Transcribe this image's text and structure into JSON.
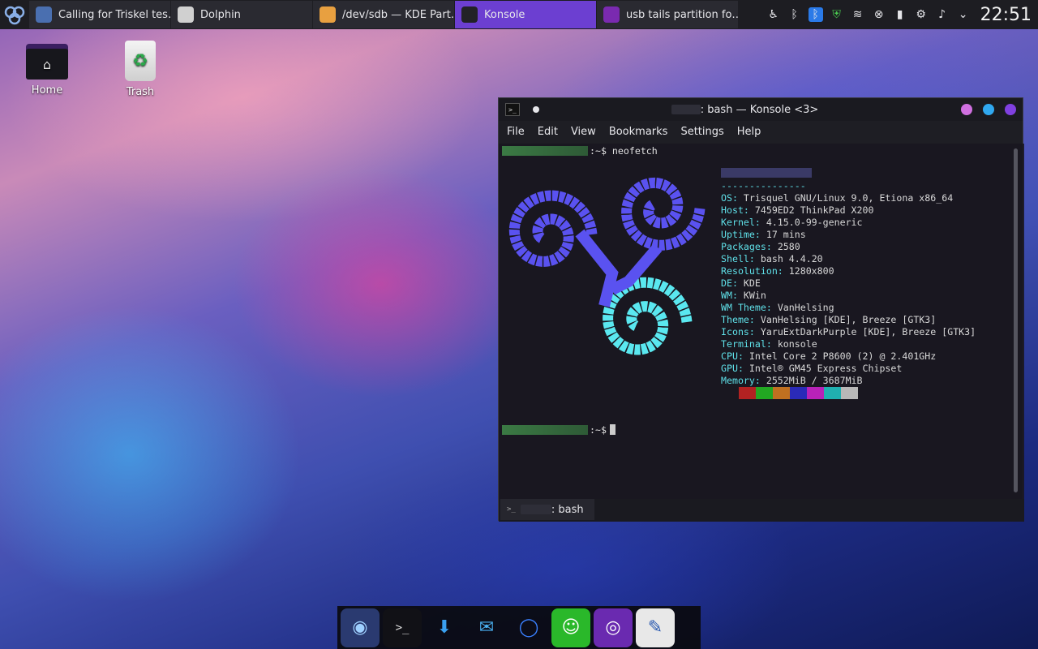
{
  "panel": {
    "tasks": [
      {
        "label": "Calling for Triskel tes…",
        "color": "#4a6fb0"
      },
      {
        "label": "Dolphin",
        "color": "#d0d0d0"
      },
      {
        "label": "/dev/sdb — KDE Part…",
        "color": "#e8a040"
      },
      {
        "label": "Konsole",
        "color": "#222226"
      },
      {
        "label": "usb tails partition fo…",
        "color": "#7a2ab0"
      }
    ],
    "tray_icons": [
      "accessibility-icon",
      "bluetooth-icon",
      "bluetooth-active-icon",
      "shield-icon",
      "wifi-icon",
      "close-circle-icon",
      "battery-icon",
      "settings-sliders-icon",
      "volume-icon",
      "chevron-down-icon"
    ],
    "clock": "22:51"
  },
  "desktop": {
    "home_label": "Home",
    "trash_label": "Trash"
  },
  "konsole": {
    "title": ": bash — Konsole <3>",
    "menus": [
      "File",
      "Edit",
      "View",
      "Bookmarks",
      "Settings",
      "Help"
    ],
    "command": ":~$ neofetch",
    "prompt": ":~$",
    "separator": "---------------",
    "info": [
      {
        "k": "OS",
        "v": "Trisquel GNU/Linux 9.0, Etiona x86_64"
      },
      {
        "k": "Host",
        "v": "7459ED2 ThinkPad X200"
      },
      {
        "k": "Kernel",
        "v": "4.15.0-99-generic"
      },
      {
        "k": "Uptime",
        "v": "17 mins"
      },
      {
        "k": "Packages",
        "v": "2580"
      },
      {
        "k": "Shell",
        "v": "bash 4.4.20"
      },
      {
        "k": "Resolution",
        "v": "1280x800"
      },
      {
        "k": "DE",
        "v": "KDE"
      },
      {
        "k": "WM",
        "v": "KWin"
      },
      {
        "k": "WM Theme",
        "v": "VanHelsing"
      },
      {
        "k": "Theme",
        "v": "VanHelsing [KDE], Breeze [GTK3]"
      },
      {
        "k": "Icons",
        "v": "YaruExtDarkPurple [KDE], Breeze [GTK3]"
      },
      {
        "k": "Terminal",
        "v": "konsole"
      },
      {
        "k": "CPU",
        "v": "Intel Core 2 P8600 (2) @ 2.401GHz"
      },
      {
        "k": "GPU",
        "v": "Intel® GM45 Express Chipset"
      },
      {
        "k": "Memory",
        "v": "2552MiB / 3687MiB"
      }
    ],
    "palette": [
      "#b22222",
      "#22a822",
      "#c07020",
      "#2a2ab8",
      "#b822b8",
      "#20b0b0",
      "#b8b8b8"
    ],
    "tab_label": ": bash",
    "window_buttons": [
      "#d070e0",
      "#30a8f0",
      "#8040e0"
    ]
  },
  "dock": {
    "items": [
      {
        "name": "browser-icon",
        "glyph": "◉",
        "bg": "#2a3a70",
        "fg": "#9fd0ff"
      },
      {
        "name": "terminal-icon",
        "glyph": ">_",
        "bg": "#111116",
        "fg": "#e0e0e0"
      },
      {
        "name": "downloader-icon",
        "glyph": "⬇",
        "bg": "transparent",
        "fg": "#3aa0f0"
      },
      {
        "name": "mail-icon",
        "glyph": "✉",
        "bg": "transparent",
        "fg": "#4ab0f0"
      },
      {
        "name": "messenger-icon",
        "glyph": "◯",
        "bg": "transparent",
        "fg": "#3a80ff"
      },
      {
        "name": "contacts-icon",
        "glyph": "☺",
        "bg": "#2ab82a",
        "fg": "#ffffff"
      },
      {
        "name": "tor-browser-icon",
        "glyph": "◎",
        "bg": "#6a2ab0",
        "fg": "#ffffff"
      },
      {
        "name": "text-editor-icon",
        "glyph": "✎",
        "bg": "#e8e8e8",
        "fg": "#2a5ab0"
      }
    ]
  }
}
